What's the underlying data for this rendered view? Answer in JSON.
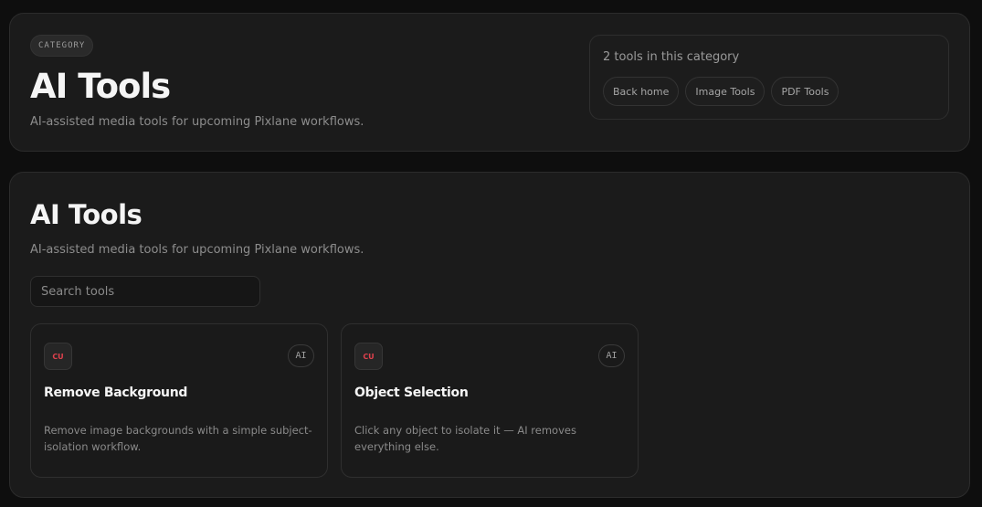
{
  "hero": {
    "badge": "CATEGORY",
    "title": "AI Tools",
    "description": "AI-assisted media tools for upcoming Pixlane workflows.",
    "info": {
      "count_text": "2 tools in this category",
      "links": [
        {
          "label": "Back home"
        },
        {
          "label": "Image Tools"
        },
        {
          "label": "PDF Tools"
        }
      ]
    }
  },
  "main": {
    "title": "AI Tools",
    "description": "AI-assisted media tools for upcoming Pixlane workflows.",
    "search": {
      "placeholder": "Search tools",
      "value": ""
    },
    "cards": [
      {
        "icon_text": "CU",
        "tag": "AI",
        "title": "Remove Background",
        "description": "Remove image backgrounds with a simple subject-isolation workflow."
      },
      {
        "icon_text": "CU",
        "tag": "AI",
        "title": "Object Selection",
        "description": "Click any object to isolate it — AI removes everything else."
      }
    ]
  },
  "colors": {
    "background": "#0e0e0e",
    "panel": "#1b1b1b",
    "icon_accent": "#e0414d"
  }
}
